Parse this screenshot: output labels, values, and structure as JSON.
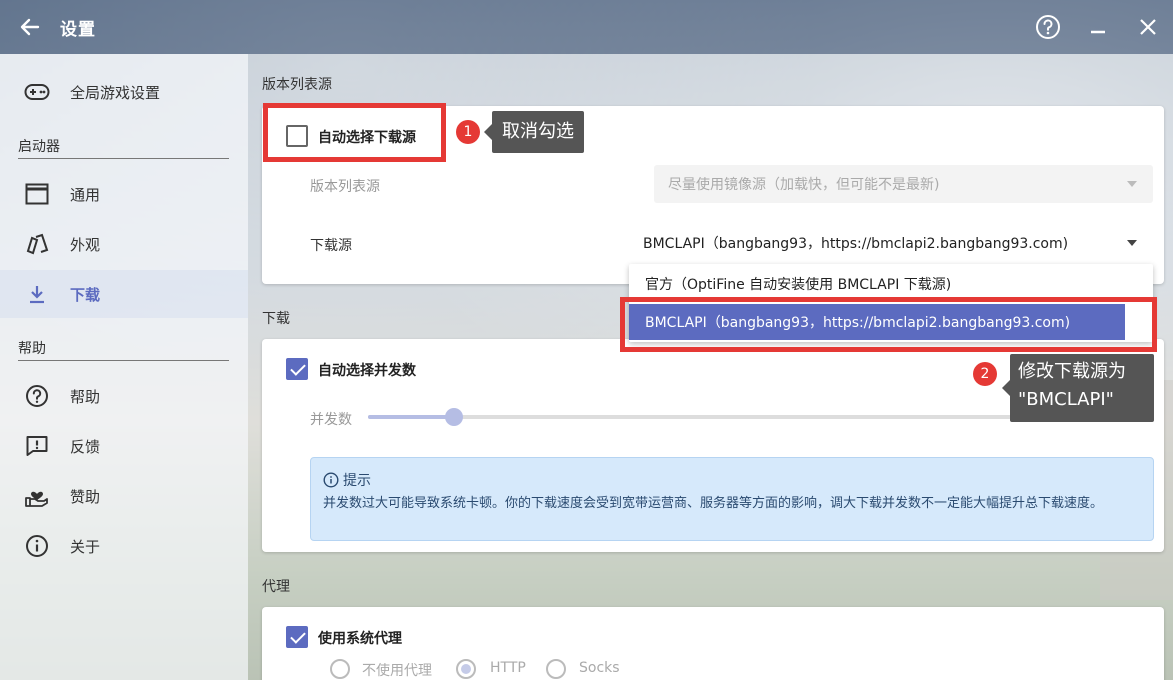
{
  "titlebar": {
    "title": "设置"
  },
  "sidebar": {
    "global_game_settings": "全局游戏设置",
    "group_launcher": "启动器",
    "items_launcher": [
      "通用",
      "外观",
      "下载"
    ],
    "group_help": "帮助",
    "items_help": [
      "帮助",
      "反馈",
      "赞助",
      "关于"
    ],
    "active_item": "下载"
  },
  "version_source": {
    "section_title": "版本列表源",
    "auto_select_label": "自动选择下载源",
    "auto_select_checked": false,
    "version_list_label": "版本列表源",
    "version_list_value": "尽量使用镜像源（加载快，但可能不是最新)",
    "download_source_label": "下载源",
    "download_source_value": "BMCLAPI（bangbang93，https://bmclapi2.bangbang93.com)",
    "dropdown_options": [
      "官方（OptiFine 自动安装使用 BMCLAPI 下载源)",
      "BMCLAPI（bangbang93，https://bmclapi2.bangbang93.com)"
    ],
    "dropdown_selected_index": 1
  },
  "download": {
    "section_title": "下载",
    "auto_concurrency_label": "自动选择并发数",
    "auto_concurrency_checked": true,
    "concurrency_label": "并发数",
    "concurrency_value": "32",
    "concurrency_fraction": 0.12,
    "hint_title": "提示",
    "hint_body": "并发数过大可能导致系统卡顿。你的下载速度会受到宽带运营商、服务器等方面的影响，调大下载并发数不一定能大幅提升总下载速度。"
  },
  "proxy": {
    "section_title": "代理",
    "use_system_proxy_label": "使用系统代理",
    "use_system_proxy_checked": true,
    "options": [
      "不使用代理",
      "HTTP",
      "Socks"
    ],
    "selected": "HTTP"
  },
  "annotations": {
    "step1_number": "1",
    "step1_text": "取消勾选",
    "step2_number": "2",
    "step2_text_line1": "修改下载源为",
    "step2_text_line2": "\"BMCLAPI\""
  },
  "colors": {
    "accent": "#5c6bc0",
    "annotation_red": "#e53935"
  }
}
